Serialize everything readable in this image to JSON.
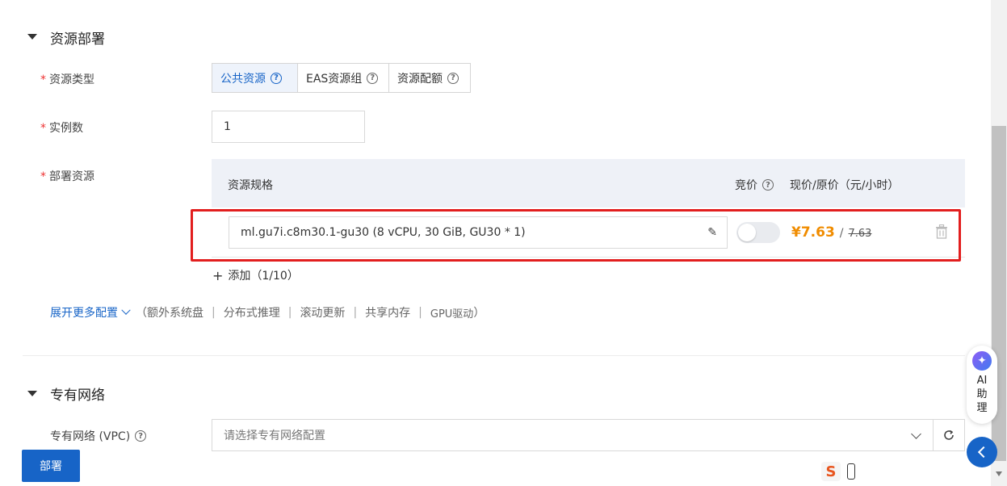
{
  "sections": {
    "deploy": {
      "title": "资源部署"
    },
    "network": {
      "title": "专有网络"
    }
  },
  "resource_type": {
    "label": "资源类型",
    "options": [
      {
        "label": "公共资源",
        "active": true
      },
      {
        "label": "EAS资源组",
        "active": false
      },
      {
        "label": "资源配额",
        "active": false
      }
    ]
  },
  "instances": {
    "label": "实例数",
    "value": "1"
  },
  "deploy_resource": {
    "label": "部署资源",
    "columns": {
      "spec": "资源规格",
      "bid": "竞价",
      "price": "现价/原价（元/小时）"
    },
    "row": {
      "spec": "ml.gu7i.c8m30.1-gu30  (8 vCPU, 30 GiB, GU30 * 1)",
      "current_price": "¥7.63",
      "price_sep": "/",
      "original_price": "7.63",
      "bid_enabled": false
    },
    "add_label": "添加（1/10）"
  },
  "more_config": {
    "link": "展开更多配置",
    "open_paren": "（",
    "items": [
      "额外系统盘",
      "分布式推理",
      "滚动更新",
      "共享内存",
      "GPU驱动"
    ],
    "close_paren": "）"
  },
  "vpc": {
    "label": "专有网络 (VPC)",
    "placeholder": "请选择专有网络配置"
  },
  "deploy_button": "部署",
  "ai_assistant": {
    "chars": [
      "AI",
      "助",
      "理"
    ]
  },
  "colors": {
    "accent": "#1764c7",
    "price": "#f08c00",
    "highlight": "#e21e1e"
  }
}
